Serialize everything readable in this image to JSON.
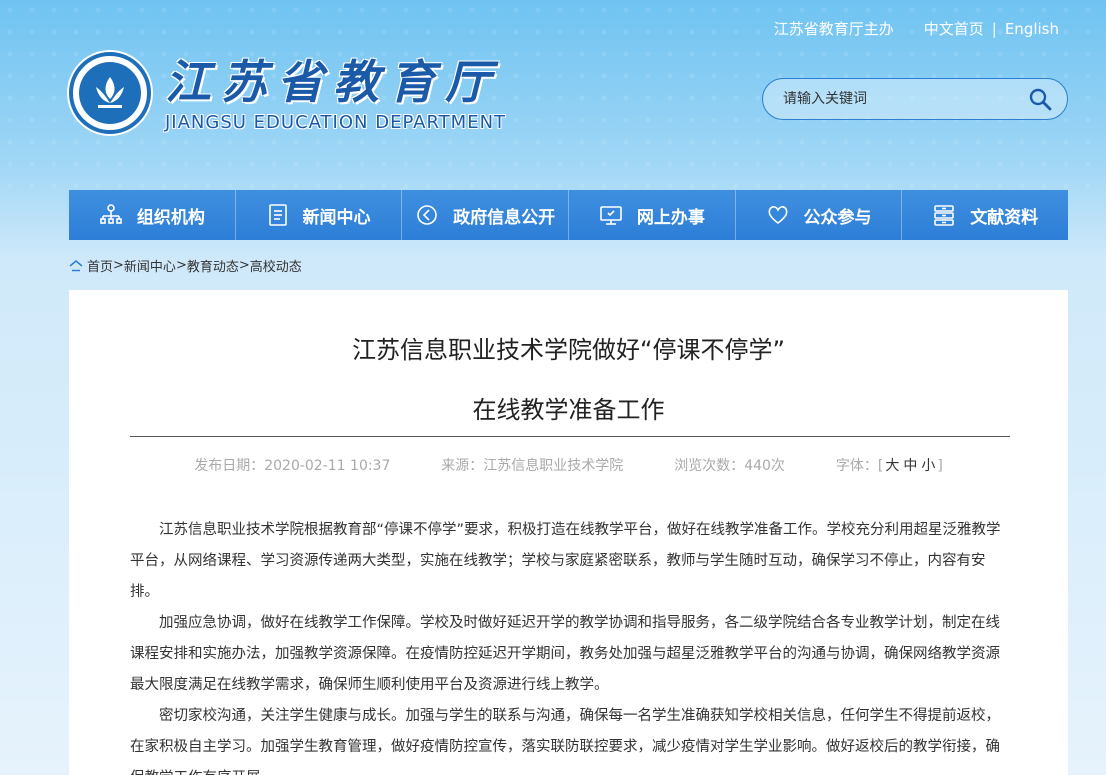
{
  "header": {
    "host_text": "江苏省教育厅主办",
    "lang_cn": "中文首页",
    "lang_sep": "|",
    "lang_en": "English",
    "logo_cn": "江苏省教育厅",
    "logo_en": "JIANGSU EDUCATION DEPARTMENT"
  },
  "search": {
    "placeholder": "请输入关键词",
    "icon": "search-icon"
  },
  "nav": {
    "items": [
      {
        "label": "组织机构",
        "icon": "org-chart-icon"
      },
      {
        "label": "新闻中心",
        "icon": "document-icon"
      },
      {
        "label": "政府信息公开",
        "icon": "announcement-icon"
      },
      {
        "label": "网上办事",
        "icon": "monitor-icon"
      },
      {
        "label": "公众参与",
        "icon": "heart-icon"
      },
      {
        "label": "文献资料",
        "icon": "archive-icon"
      }
    ]
  },
  "breadcrumb": {
    "home": "首页",
    "sep": ">",
    "items": [
      "新闻中心",
      "教育动态",
      "高校动态"
    ]
  },
  "article": {
    "title_line1": "江苏信息职业技术学院做好“停课不停学”",
    "title_line2": "在线教学准备工作",
    "meta": {
      "date_label": "发布日期：",
      "date": "2020-02-11 10:37",
      "source_label": "来源：",
      "source": "江苏信息职业技术学院",
      "views_label": "浏览次数：",
      "views": "440次",
      "font_label": "字体：",
      "font_open": "[",
      "font_large": "大",
      "font_medium": "中",
      "font_small": "小",
      "font_close": "]"
    },
    "paragraphs": [
      "江苏信息职业技术学院根据教育部“停课不停学”要求，积极打造在线教学平台，做好在线教学准备工作。学校充分利用超星泛雅教学平台，从网络课程、学习资源传递两大类型，实施在线教学；学校与家庭紧密联系，教师与学生随时互动，确保学习不停止，内容有安排。",
      "加强应急协调，做好在线教学工作保障。学校及时做好延迟开学的教学协调和指导服务，各二级学院结合各专业教学计划，制定在线课程安排和实施办法，加强教学资源保障。在疫情防控延迟开学期间，教务处加强与超星泛雅教学平台的沟通与协调，确保网络教学资源最大限度满足在线教学需求，确保师生顺利使用平台及资源进行线上教学。",
      "密切家校沟通，关注学生健康与成长。加强与学生的联系与沟通，确保每一名学生准确获知学校相关信息，任何学生不得提前返校，在家积极自主学习。加强学生教育管理，做好疫情防控宣传，落实联防联控要求，减少疫情对学生学业影响。做好返校后的教学衔接，确保教学工作有序开展。"
    ]
  }
}
